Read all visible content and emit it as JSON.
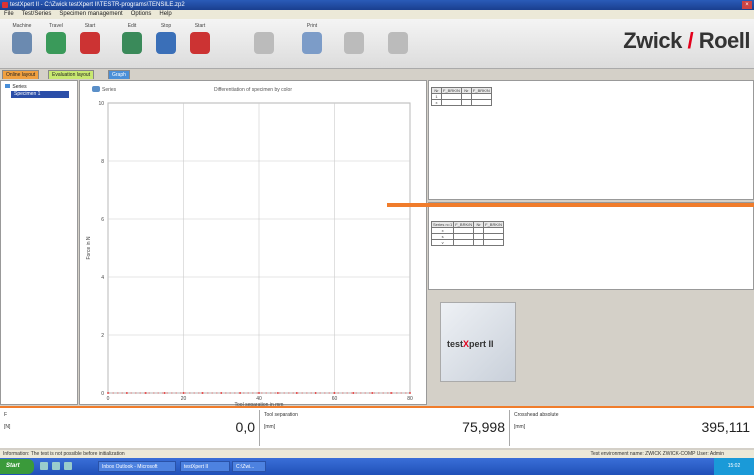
{
  "window": {
    "title": "testXpert II - C:\\Zwick testXpert II\\TESTR-programs\\TENSILE.zp2"
  },
  "menu": [
    "File",
    "Test/Series",
    "Specimen management",
    "Options",
    "Help"
  ],
  "toolbar": {
    "tools": [
      {
        "label": "Machine",
        "icon": "machine-icon",
        "color": "#6b8ab0"
      },
      {
        "label": "Travel",
        "icon": "travel-icon",
        "color": "#3a9a5a"
      },
      {
        "label": "Start",
        "icon": "start-icon",
        "color": "#c33"
      },
      {
        "label": "Edit",
        "icon": "edit-icon",
        "color": "#3a8a5a"
      },
      {
        "label": "Stop",
        "icon": "stop-icon",
        "color": "#3a6fb8"
      },
      {
        "label": "Start",
        "icon": "record-icon",
        "color": "#c33"
      },
      {
        "label": "",
        "icon": "document-icon",
        "color": "#bbb"
      },
      {
        "label": "Print",
        "icon": "print-icon",
        "color": "#7c9cc8"
      },
      {
        "label": "",
        "icon": "zero-icon",
        "color": "#bbb"
      },
      {
        "label": "",
        "icon": "tools-icon",
        "color": "#bbb"
      }
    ],
    "brand": {
      "left": "Zwick",
      "right": "Roell"
    }
  },
  "tabs": [
    {
      "label": "Online layout",
      "color": "#f0a040"
    },
    {
      "label": "Evaluation layout",
      "color": "#c8e870"
    },
    {
      "label": "Graph",
      "color": "#4a8fd8"
    }
  ],
  "tree": {
    "root": "Series",
    "child": "Specimen 1"
  },
  "chart_data": {
    "type": "line",
    "title": "Differentiation of specimen by color",
    "series_label": "Series",
    "xlabel": "Tool separation in mm",
    "ylabel": "Force in N",
    "xlim": [
      0,
      80
    ],
    "ylim": [
      0,
      10
    ],
    "x_ticks": [
      0,
      20,
      40,
      60,
      80
    ],
    "y_ticks": [
      0,
      2,
      4,
      6,
      8,
      10
    ],
    "grid": true,
    "series": [
      {
        "color": "#e02020",
        "x": [
          0,
          5,
          10,
          15,
          20,
          25,
          30,
          35,
          40,
          45,
          50,
          55,
          60,
          65,
          70,
          75,
          80
        ],
        "y": [
          0,
          0,
          0,
          0,
          0,
          0,
          0,
          0,
          0,
          0,
          0,
          0,
          0,
          0,
          0,
          0,
          0
        ]
      }
    ]
  },
  "results_top": {
    "header": [
      "Nr",
      "F_BRK/N",
      "Nr",
      "F_BRK/N"
    ],
    "rows": [
      [
        "1",
        "",
        "",
        ""
      ],
      [
        "x",
        "",
        "",
        ""
      ]
    ]
  },
  "results_mid": {
    "header": [
      "Series n=1",
      "F_BRK/N",
      "Nr",
      "F_BRK/N"
    ],
    "rows": [
      [
        "x",
        "",
        "",
        ""
      ],
      [
        "s",
        "",
        "",
        ""
      ],
      [
        "v",
        "",
        "",
        ""
      ]
    ]
  },
  "logo": {
    "text_a": "test",
    "text_x": "X",
    "text_b": "pert II"
  },
  "status": [
    {
      "label": "F",
      "unit": "[N]",
      "value": "0,0"
    },
    {
      "label": "Tool separation",
      "unit": "[mm]",
      "value": "75,998"
    },
    {
      "label": "Crosshead absolute",
      "unit": "[mm]",
      "value": "395,111"
    }
  ],
  "message": {
    "left": "Information: The test is not possible before initialization",
    "right": "Test environment name: ZWICK  ZWICK-COMP  User: Admin"
  },
  "taskbar": {
    "start": "Start",
    "tasks": [
      "Inbox Outlook - Microsoft",
      "testXpert II",
      "C:\\Zwi..."
    ],
    "tray": "15:02"
  }
}
